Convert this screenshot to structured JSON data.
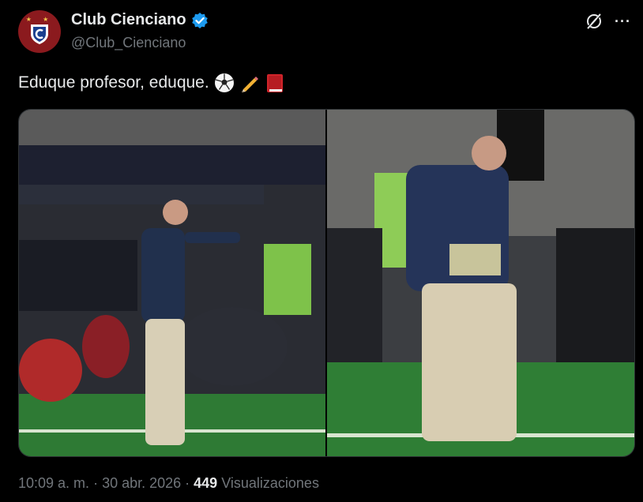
{
  "post": {
    "author": {
      "display_name": "Club Cienciano",
      "handle": "@Club_Cienciano",
      "verified": true,
      "avatar_icon": "club-crest-icon"
    },
    "text": "Eduque profesor, eduque.",
    "emojis": [
      "soccer-ball-icon",
      "pencil-icon",
      "red-book-icon"
    ],
    "media": [
      {
        "label": "photo-coach-sideline-pointing"
      },
      {
        "label": "photo-coach-sideline-standing"
      }
    ],
    "meta": {
      "time": "10:09 a. m.",
      "separator": "·",
      "date": "30 abr. 2026",
      "separator2": "·",
      "views_count": "449",
      "views_label": "Visualizaciones"
    }
  },
  "actions": {
    "grok_icon": "grok-icon",
    "more_icon": "more-options-icon"
  },
  "colors": {
    "background": "#000000",
    "text": "#e7e9ea",
    "muted": "#71767b",
    "verified": "#1d9bf0",
    "avatar_bg": "#8b1a1e"
  }
}
